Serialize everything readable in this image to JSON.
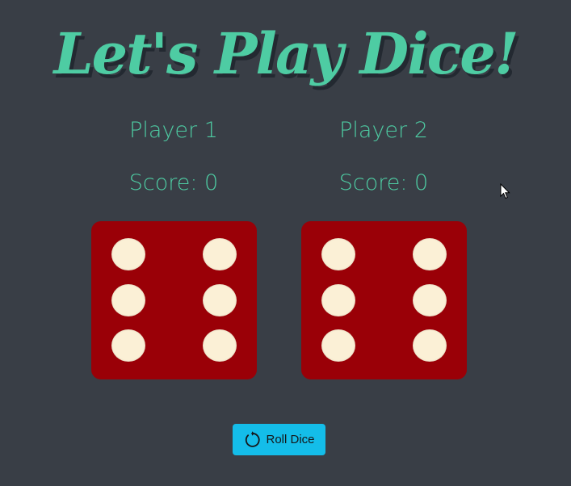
{
  "title": "Let's Play Dice!",
  "players": [
    {
      "name": "Player 1",
      "score_text": "Score: 0",
      "die_value": 6
    },
    {
      "name": "Player 2",
      "score_text": "Score: 0",
      "die_value": 6
    }
  ],
  "roll_button": {
    "label": "Roll Dice",
    "icon": "refresh-icon"
  },
  "colors": {
    "background": "#393e46",
    "accent": "#4ecca3",
    "die": "#9a0007",
    "pip": "#fbf0d6",
    "button": "#14bde9"
  }
}
